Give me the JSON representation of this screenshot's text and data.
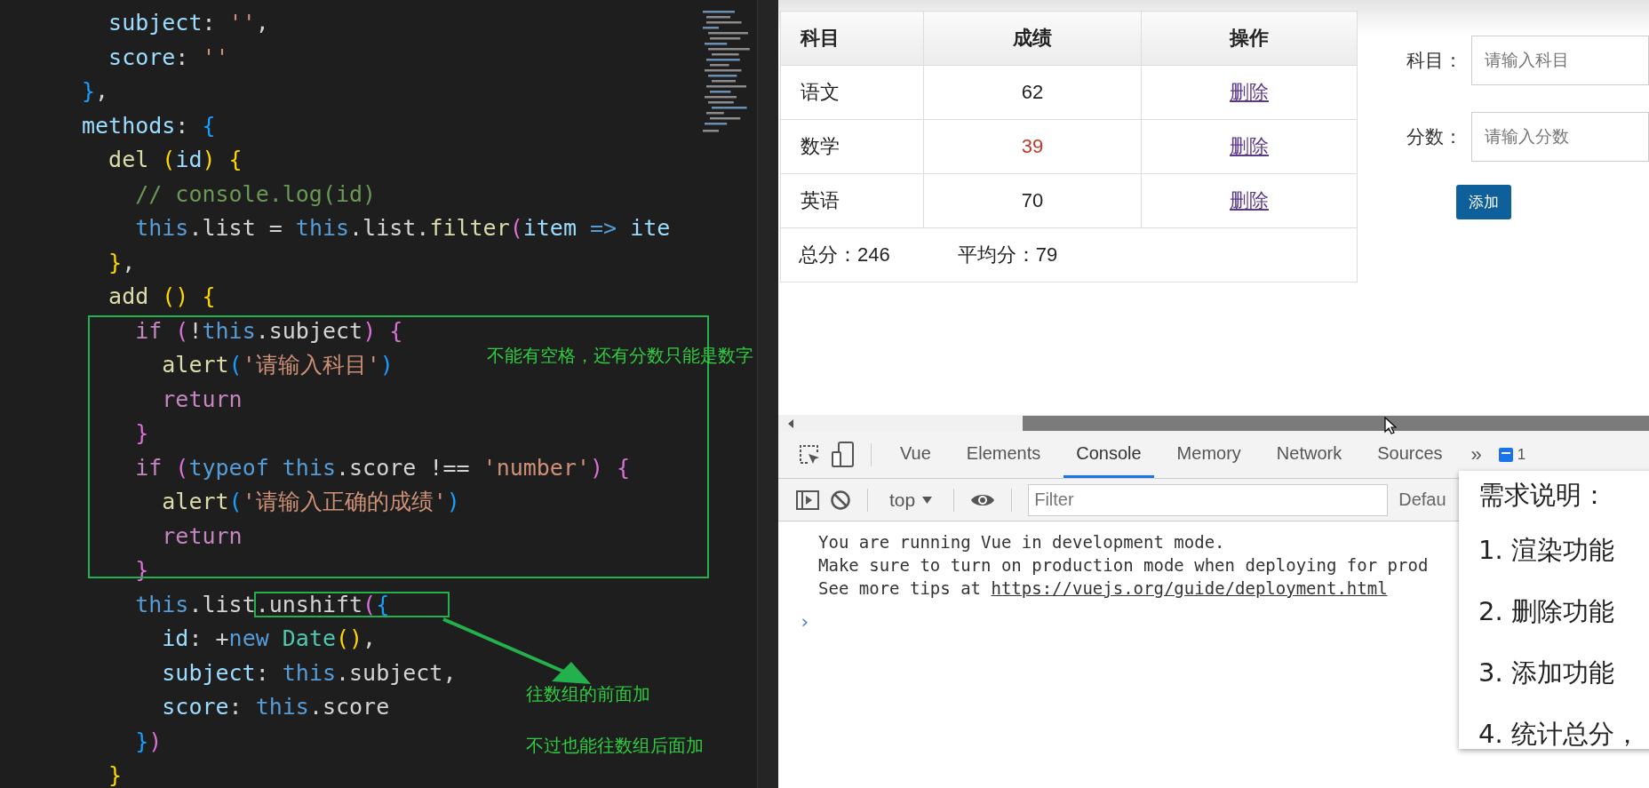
{
  "editor": {
    "lines": [
      [
        {
          "kind": "prop",
          "text": "  subject"
        },
        {
          "kind": "plain",
          "text": ": "
        },
        {
          "kind": "string",
          "text": "''"
        },
        {
          "kind": "plain",
          "text": ","
        }
      ],
      [
        {
          "kind": "prop",
          "text": "  score"
        },
        {
          "kind": "plain",
          "text": ": "
        },
        {
          "kind": "string",
          "text": "''"
        }
      ],
      [
        {
          "kind": "bracket3",
          "text": "}"
        },
        {
          "kind": "plain",
          "text": ","
        }
      ],
      [
        {
          "kind": "prop",
          "text": "methods"
        },
        {
          "kind": "plain",
          "text": ": "
        },
        {
          "kind": "bracket3",
          "text": "{"
        }
      ],
      [
        {
          "kind": "function",
          "text": "  del"
        },
        {
          "kind": "bracket1",
          "text": " ("
        },
        {
          "kind": "prop",
          "text": "id"
        },
        {
          "kind": "bracket1",
          "text": ")"
        },
        {
          "kind": "bracket1",
          "text": " {"
        }
      ],
      [
        {
          "kind": "comment",
          "text": "    // console.log(id)"
        }
      ],
      [
        {
          "kind": "storage",
          "text": "    this"
        },
        {
          "kind": "plain",
          "text": ".list = "
        },
        {
          "kind": "storage",
          "text": "this"
        },
        {
          "kind": "plain",
          "text": ".list."
        },
        {
          "kind": "function",
          "text": "filter"
        },
        {
          "kind": "bracket2",
          "text": "("
        },
        {
          "kind": "prop",
          "text": "item"
        },
        {
          "kind": "storage",
          "text": " =>"
        },
        {
          "kind": "prop",
          "text": " ite"
        }
      ],
      [
        {
          "kind": "bracket1",
          "text": "  }"
        },
        {
          "kind": "plain",
          "text": ","
        }
      ],
      [
        {
          "kind": "function",
          "text": "  add"
        },
        {
          "kind": "bracket1",
          "text": " ()"
        },
        {
          "kind": "bracket1",
          "text": " {"
        }
      ],
      [
        {
          "kind": "keyword",
          "text": "    if"
        },
        {
          "kind": "bracket2",
          "text": " ("
        },
        {
          "kind": "plain",
          "text": "!"
        },
        {
          "kind": "storage",
          "text": "this"
        },
        {
          "kind": "plain",
          "text": ".subject"
        },
        {
          "kind": "bracket2",
          "text": ")"
        },
        {
          "kind": "bracket2",
          "text": " {"
        }
      ],
      [
        {
          "kind": "function",
          "text": "      alert"
        },
        {
          "kind": "bracket3",
          "text": "("
        },
        {
          "kind": "string",
          "text": "'请输入科目'"
        },
        {
          "kind": "bracket3",
          "text": ")"
        }
      ],
      [
        {
          "kind": "keyword",
          "text": "      return"
        }
      ],
      [
        {
          "kind": "bracket2",
          "text": "    }"
        }
      ],
      [
        {
          "kind": "keyword",
          "text": "    if"
        },
        {
          "kind": "bracket2",
          "text": " ("
        },
        {
          "kind": "storage",
          "text": "typeof"
        },
        {
          "kind": "storage",
          "text": " this"
        },
        {
          "kind": "plain",
          "text": ".score !== "
        },
        {
          "kind": "string",
          "text": "'number'"
        },
        {
          "kind": "bracket2",
          "text": ")"
        },
        {
          "kind": "bracket2",
          "text": " {"
        }
      ],
      [
        {
          "kind": "function",
          "text": "      alert"
        },
        {
          "kind": "bracket3",
          "text": "("
        },
        {
          "kind": "string",
          "text": "'请输入正确的成绩'"
        },
        {
          "kind": "bracket3",
          "text": ")"
        }
      ],
      [
        {
          "kind": "keyword",
          "text": "      return"
        }
      ],
      [
        {
          "kind": "bracket2",
          "text": "    }"
        }
      ],
      [
        {
          "kind": "storage",
          "text": "    this",
          "framed": false
        },
        {
          "kind": "plain",
          "text": ".list",
          "framed": false
        },
        {
          "kind": "plain",
          "text": ".unshift",
          "framed": true
        },
        {
          "kind": "bracket2",
          "text": "(",
          "framed": true
        },
        {
          "kind": "bracket3",
          "text": "{",
          "framed": true
        }
      ],
      [
        {
          "kind": "prop",
          "text": "      id"
        },
        {
          "kind": "plain",
          "text": ": +"
        },
        {
          "kind": "storage",
          "text": "new"
        },
        {
          "kind": "class",
          "text": " Date"
        },
        {
          "kind": "bracket1",
          "text": "()"
        },
        {
          "kind": "plain",
          "text": ","
        }
      ],
      [
        {
          "kind": "prop",
          "text": "      subject"
        },
        {
          "kind": "plain",
          "text": ": "
        },
        {
          "kind": "storage",
          "text": "this"
        },
        {
          "kind": "plain",
          "text": ".subject,"
        }
      ],
      [
        {
          "kind": "prop",
          "text": "      score"
        },
        {
          "kind": "plain",
          "text": ": "
        },
        {
          "kind": "storage",
          "text": "this"
        },
        {
          "kind": "plain",
          "text": ".score"
        }
      ],
      [
        {
          "kind": "bracket3",
          "text": "    }"
        },
        {
          "kind": "bracket2",
          "text": ")"
        }
      ],
      [
        {
          "kind": "bracket1",
          "text": "  }"
        }
      ]
    ]
  },
  "annotations": {
    "notes": [
      "不能有空格，还有分数只能是数字",
      "往数组的前面加",
      "不过也能往数组后面加"
    ]
  },
  "page": {
    "table": {
      "columns": [
        "科目",
        "成绩",
        "操作"
      ],
      "rows": [
        {
          "subject": "语文",
          "score": "62",
          "low": false,
          "action": "删除"
        },
        {
          "subject": "数学",
          "score": "39",
          "low": true,
          "action": "删除"
        },
        {
          "subject": "英语",
          "score": "70",
          "low": false,
          "action": "删除"
        }
      ],
      "footer": {
        "total": "总分：246",
        "average": "平均分：79"
      }
    },
    "form": {
      "fields": [
        {
          "label": "科目：",
          "placeholder": "请输入科目"
        },
        {
          "label": "分数：",
          "placeholder": "请输入分数"
        }
      ],
      "button": "添加"
    }
  },
  "devtools": {
    "tabs": [
      {
        "label": "Vue",
        "selected": false
      },
      {
        "label": "Elements",
        "selected": false
      },
      {
        "label": "Console",
        "selected": true
      },
      {
        "label": "Memory",
        "selected": false
      },
      {
        "label": "Network",
        "selected": false
      },
      {
        "label": "Sources",
        "selected": false
      }
    ],
    "more": "»",
    "badge": "1",
    "context": "top",
    "filter_placeholder": "Filter",
    "levels": "Defau",
    "messages": [
      {
        "text": "You are running Vue in development mode."
      },
      {
        "text": "Make sure to turn on production mode when deploying for prod"
      },
      {
        "text": "See more tips at ",
        "link": "https://vuejs.org/guide/deployment.html"
      }
    ],
    "prompt": "›"
  },
  "requirements": {
    "title": "需求说明：",
    "items": [
      "1. 渲染功能",
      "2. 删除功能",
      "3. 添加功能",
      "4. 统计总分，"
    ]
  }
}
